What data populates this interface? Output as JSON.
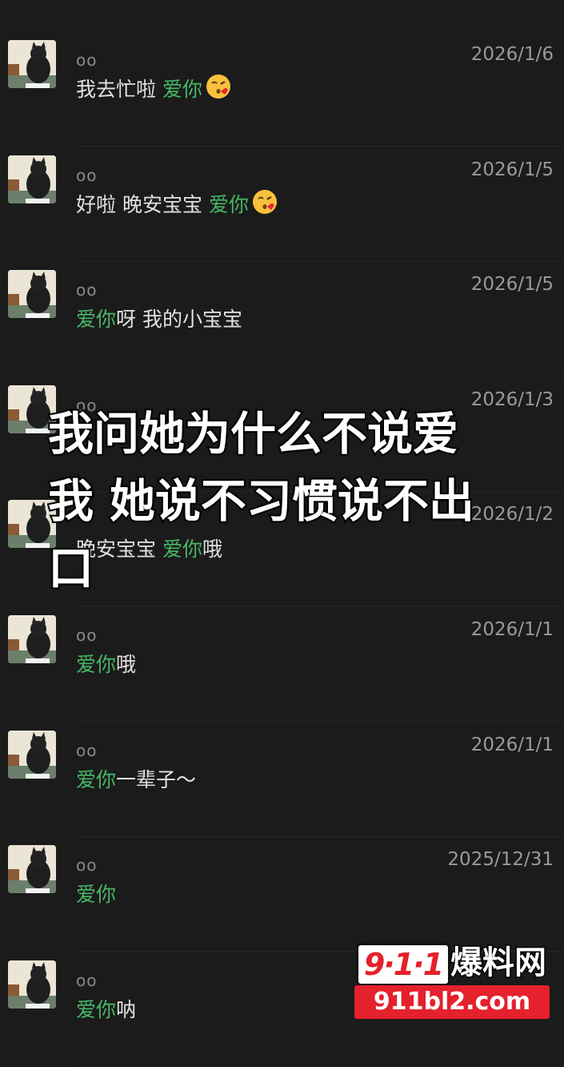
{
  "messages": [
    {
      "name": "oo",
      "date": "2026/1/6",
      "green": "",
      "text_before": "我去忙啦 ",
      "green_after": "爱你",
      "text_after": "",
      "emoji": true
    },
    {
      "name": "oo",
      "date": "2026/1/5",
      "green": "",
      "text_before": "好啦 晚安宝宝 ",
      "green_after": "爱你",
      "text_after": "",
      "emoji": true
    },
    {
      "name": "oo",
      "date": "2026/1/5",
      "green": "爱你",
      "text_before": "呀 我的小宝宝",
      "green_after": "",
      "text_after": "",
      "emoji": false
    },
    {
      "name": "oo",
      "date": "2026/1/3",
      "green": "",
      "text_before": "",
      "green_after": "",
      "text_after": "",
      "emoji": false
    },
    {
      "name": "",
      "date": "2026/1/2",
      "green": "",
      "text_before": "晚安宝宝 ",
      "green_after": "爱你",
      "text_after": "哦",
      "emoji": false
    },
    {
      "name": "oo",
      "date": "2026/1/1",
      "green": "爱你",
      "text_before": "哦",
      "green_after": "",
      "text_after": "",
      "emoji": false
    },
    {
      "name": "oo",
      "date": "2026/1/1",
      "green": "爱你",
      "text_before": "一辈子～",
      "green_after": "",
      "text_after": "",
      "emoji": false
    },
    {
      "name": "oo",
      "date": "2025/12/31",
      "green": "爱你",
      "text_before": "",
      "green_after": "",
      "text_after": "",
      "emoji": false
    },
    {
      "name": "oo",
      "date": "",
      "green": "爱你",
      "text_before": "呐",
      "green_after": "",
      "text_after": "",
      "emoji": false
    }
  ],
  "overlay_caption": {
    "line1": "我问她为什么不说爱",
    "line2": "我 她说不习惯说不出",
    "line3": "口"
  },
  "watermark": {
    "box": "9·1·1",
    "name": "爆料网",
    "url": "911bl2.com"
  }
}
